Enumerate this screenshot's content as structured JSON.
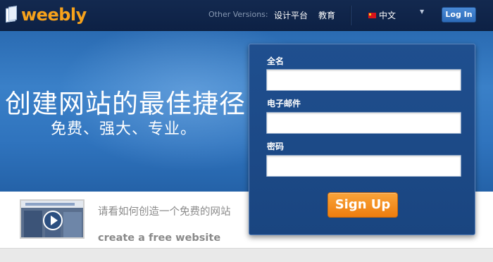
{
  "header": {
    "logo_text": "weebly",
    "other_versions_label": "Other Versions:",
    "nav": [
      "设计平台",
      "教育"
    ],
    "language": "中文",
    "login_label": "Log In"
  },
  "hero": {
    "title": "创建网站的最佳捷径",
    "subtitle": "免费、强大、专业。"
  },
  "signup_form": {
    "name_label": "全名",
    "name_value": "",
    "email_label": "电子邮件",
    "email_value": "",
    "password_label": "密码",
    "password_value": "",
    "submit_label": "Sign Up"
  },
  "video": {
    "caption_cn": "请看如何创造一个免费的网站",
    "caption_en": "create a free website"
  },
  "colors": {
    "brand_orange": "#f7a21b",
    "header_navy": "#13294f",
    "hero_blue": "#3a80c8",
    "form_blue": "#1f4f8f",
    "signup_orange": "#ee7d0e"
  }
}
